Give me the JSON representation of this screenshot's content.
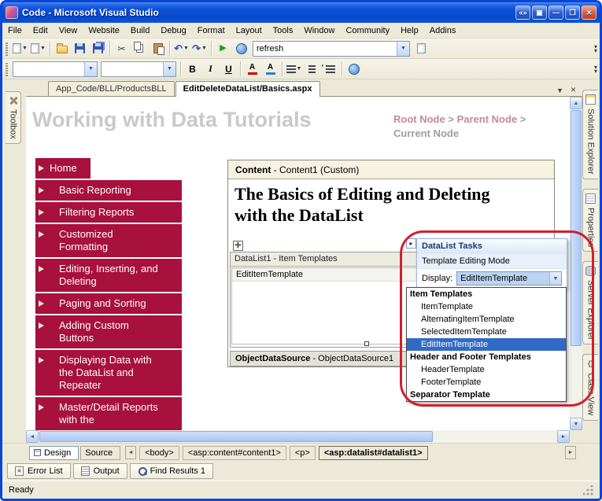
{
  "window": {
    "title": "Code - Microsoft Visual Studio",
    "status_text": "Ready"
  },
  "menu_items": [
    "File",
    "Edit",
    "View",
    "Website",
    "Build",
    "Debug",
    "Format",
    "Layout",
    "Tools",
    "Window",
    "Community",
    "Help",
    "Addins"
  ],
  "toolbar": {
    "refresh_value": "refresh"
  },
  "format_bar": {
    "bold": "B",
    "italic": "I",
    "underline": "U"
  },
  "document_tabs": [
    {
      "label": "App_Code/BLL/ProductsBLL"
    },
    {
      "label": "EditDeleteDataList/Basics.aspx"
    }
  ],
  "left_dock": {
    "toolbox": "Toolbox"
  },
  "right_dock": [
    "Solution Explorer",
    "Properties",
    "Server Explorer",
    "Class View"
  ],
  "page": {
    "title": "Working with Data Tutorials",
    "breadcrumb": {
      "root": "Root Node",
      "sep": ">",
      "parent": "Parent Node",
      "current": "Current Node"
    },
    "nav_items": [
      "Home",
      "Basic Reporting",
      "Filtering Reports",
      "Customized Formatting",
      "Editing, Inserting, and Deleting",
      "Paging and Sorting",
      "Adding Custom Buttons",
      "Displaying Data with the DataList and Repeater",
      "Master/Detail Reports with the"
    ],
    "content": {
      "header_bold": "Content",
      "header_rest": " - Content1 (Custom)",
      "heading": "The Basics of Editing and Deleting with the DataList",
      "datalist_header": "DataList1 - Item Templates",
      "template_label": "EditItemTemplate",
      "datasource_bold": "ObjectDataSource",
      "datasource_rest": " - ObjectDataSource1"
    },
    "smart_tag": {
      "title": "DataList Tasks",
      "subtitle": "Template Editing Mode",
      "display_label": "Display:",
      "display_value": "EditItemTemplate",
      "dropdown": [
        {
          "label": "Item Templates",
          "type": "header"
        },
        {
          "label": "ItemTemplate",
          "type": "item"
        },
        {
          "label": "AlternatingItemTemplate",
          "type": "item"
        },
        {
          "label": "SelectedItemTemplate",
          "type": "item"
        },
        {
          "label": "EditItemTemplate",
          "type": "selected"
        },
        {
          "label": "Header and Footer Templates",
          "type": "header"
        },
        {
          "label": "HeaderTemplate",
          "type": "item"
        },
        {
          "label": "FooterTemplate",
          "type": "item"
        },
        {
          "label": "Separator Template",
          "type": "header"
        }
      ]
    }
  },
  "bottom": {
    "design_label": "Design",
    "source_label": "Source",
    "tag_path": [
      "<body>",
      "<asp:content#content1>",
      "<p>",
      "<asp:datalist#datalist1>"
    ]
  },
  "panel_tabs": [
    "Error List",
    "Output",
    "Find Results 1"
  ],
  "colors": {
    "accent_maroon": "#A8103E",
    "selection_blue": "#316AC5",
    "annotation_red": "#CF2030"
  }
}
